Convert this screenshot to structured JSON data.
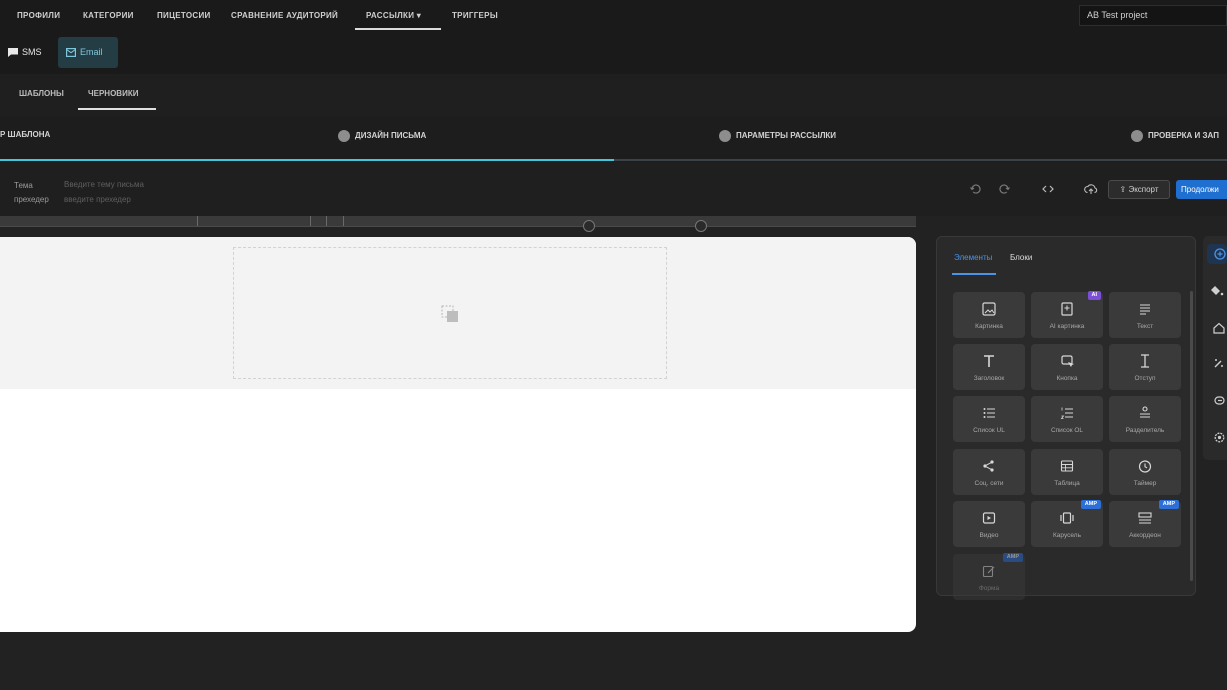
{
  "topnav": {
    "items": [
      "ПРОФИЛИ",
      "КАТЕГОРИИ",
      "ПИЦЕТОСИИ",
      "СРАВНЕНИЕ АУДИТОРИЙ",
      "РАССЫЛКИ ▾",
      "ТРИГГЕРЫ"
    ],
    "project": "AB Test project"
  },
  "channels": {
    "sms": "SMS",
    "email": "Email"
  },
  "subtabs": [
    "ШАБЛОНЫ",
    "ЧЕРНОВИКИ"
  ],
  "steps": [
    "Р ШАБЛОНА",
    "ДИЗАЙН ПИСЬМА",
    "ПАРАМЕТРЫ РАССЫЛКИ",
    "ПРОВЕРКА И ЗАП"
  ],
  "progress_fraction": 0.5,
  "subject": {
    "label": "Тема",
    "placeholder": "Введите тему письма",
    "preview_label": "прехедер",
    "preview_placeholder": "введите прехедер"
  },
  "toolbar": {
    "export": "Экспорт",
    "continue": "Продолжи"
  },
  "panel": {
    "tab_elements": "Элементы",
    "tab_blocks": "Блоки",
    "tiles": [
      {
        "label": "Картинка",
        "icon": "image-icon"
      },
      {
        "label": "AI картинка",
        "icon": "ai-image-icon",
        "badge": "AI"
      },
      {
        "label": "Текст",
        "icon": "text-lines-icon"
      },
      {
        "label": "Заголовок",
        "icon": "heading-icon"
      },
      {
        "label": "Кнопка",
        "icon": "button-icon"
      },
      {
        "label": "Отступ",
        "icon": "spacer-icon"
      },
      {
        "label": "Список UL",
        "icon": "list-ul-icon"
      },
      {
        "label": "Список OL",
        "icon": "list-ol-icon"
      },
      {
        "label": "Разделитель",
        "icon": "divider-icon"
      },
      {
        "label": "Соц. сети",
        "icon": "share-icon"
      },
      {
        "label": "Таблица",
        "icon": "table-icon"
      },
      {
        "label": "Таймер",
        "icon": "timer-icon"
      },
      {
        "label": "Видео",
        "icon": "video-icon"
      },
      {
        "label": "Карусель",
        "icon": "carousel-icon",
        "badge": "AMP"
      },
      {
        "label": "Аккордеон",
        "icon": "accordion-icon",
        "badge": "AMP"
      },
      {
        "label": "Форма",
        "icon": "form-icon",
        "badge": "AMP"
      }
    ]
  },
  "colors": {
    "accent": "#43c6dc",
    "primary": "#1f6fd1",
    "badge_ai": "#7b4fd6",
    "badge_amp": "#2d6fd8"
  }
}
